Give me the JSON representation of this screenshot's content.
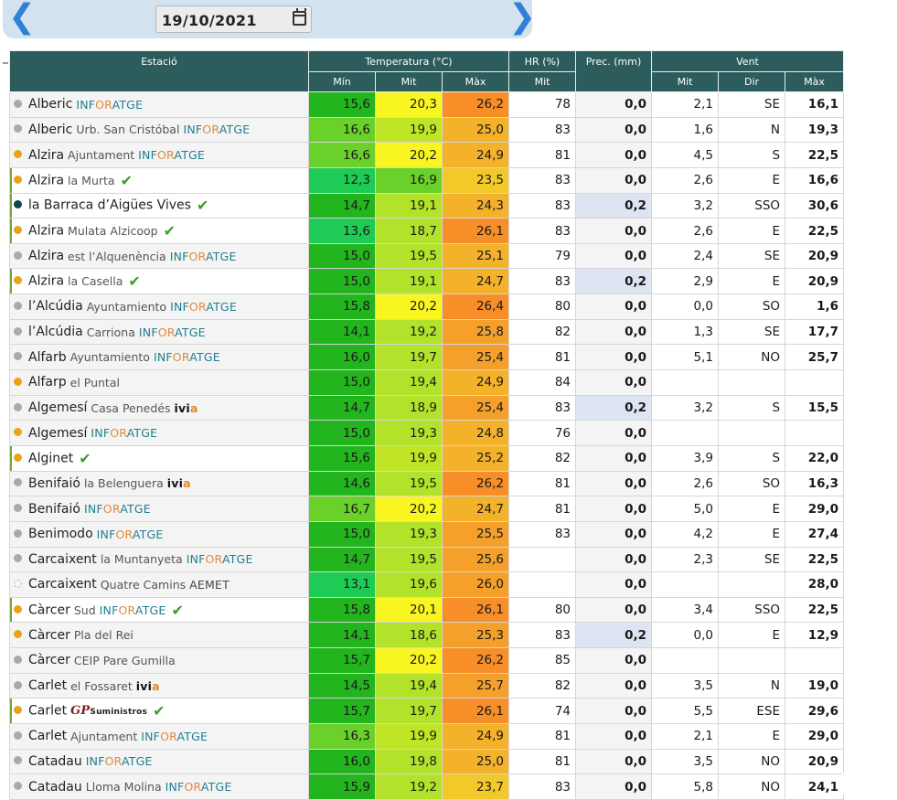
{
  "toolbar": {
    "prev_icon": "chevron-left-icon",
    "next_icon": "chevron-right-icon",
    "date_value": "19/10/2021",
    "calendar_icon": "calendar-icon",
    "prev_glyph": "❮",
    "next_glyph": "❯"
  },
  "colors": {
    "header_bg": "#2d5c5c",
    "topbar_bg": "#d2e2ef",
    "arrow": "#2f80d8",
    "dot_grey": "#a9a9a9",
    "dot_orange": "#e8a317",
    "dot_teal": "#0a4a48",
    "check": "#3f9b2a"
  },
  "table": {
    "headers_top": {
      "station": "Estació",
      "temperature": "Temperatura (°C)",
      "humidity": "HR (%)",
      "precip": "Prec. (mm)",
      "wind": "Vent"
    },
    "headers_sub": {
      "t_min": "Mín",
      "t_mit": "Mit",
      "t_max": "Màx",
      "hr_mit": "Mit",
      "v_mit": "Mit",
      "v_dir": "Dir",
      "v_max": "Màx"
    },
    "rows": [
      {
        "name": "Alberic",
        "sub": "",
        "net": "INFORATGE",
        "dot": "grey",
        "check": false,
        "owned": false,
        "tmin": "15,6",
        "tmit": "20,3",
        "tmax": "26,2",
        "hr": "78",
        "prec": "0,0",
        "prec_hi": false,
        "vmit": "2,1",
        "vdir": "SE",
        "vmax": "16,1",
        "cmin": "#22b51d",
        "cmit": "#f8f520",
        "cmax": "#f78e28"
      },
      {
        "name": "Alberic",
        "sub": "Urb. San Cristóbal",
        "net": "INFORATGE",
        "dot": "grey",
        "check": false,
        "owned": false,
        "tmin": "16,6",
        "tmit": "19,9",
        "tmax": "25,0",
        "hr": "83",
        "prec": "0,0",
        "prec_hi": false,
        "vmit": "1,6",
        "vdir": "N",
        "vmax": "19,3",
        "cmin": "#6ad12a",
        "cmit": "#c0e526",
        "cmax": "#f4b12a"
      },
      {
        "name": "Alzira",
        "sub": "Ajuntament",
        "net": "INFORATGE",
        "dot": "orange",
        "check": false,
        "owned": false,
        "tmin": "16,6",
        "tmit": "20,2",
        "tmax": "24,9",
        "hr": "81",
        "prec": "0,0",
        "prec_hi": false,
        "vmit": "4,5",
        "vdir": "S",
        "vmax": "22,5",
        "cmin": "#6ad12a",
        "cmit": "#f8f520",
        "cmax": "#f4b12a"
      },
      {
        "name": "Alzira",
        "sub": "la Murta",
        "net": "",
        "dot": "orange",
        "check": true,
        "owned": true,
        "tmin": "12,3",
        "tmit": "16,9",
        "tmax": "23,5",
        "hr": "83",
        "prec": "0,0",
        "prec_hi": false,
        "vmit": "2,6",
        "vdir": "E",
        "vmax": "16,6",
        "cmin": "#1ecb55",
        "cmit": "#6ad12a",
        "cmax": "#f3c92a"
      },
      {
        "name": "la Barraca d’Aigües Vives",
        "sub": "",
        "net": "",
        "dot": "teal",
        "check": true,
        "owned": true,
        "tmin": "14,7",
        "tmit": "19,1",
        "tmax": "24,3",
        "hr": "83",
        "prec": "0,2",
        "prec_hi": true,
        "vmit": "3,2",
        "vdir": "SSO",
        "vmax": "30,6",
        "cmin": "#22b51d",
        "cmit": "#b3e22a",
        "cmax": "#f4b12a"
      },
      {
        "name": "Alzira",
        "sub": "Mulata Alzicoop",
        "net": "",
        "dot": "orange",
        "check": true,
        "owned": true,
        "tmin": "13,6",
        "tmit": "18,7",
        "tmax": "26,1",
        "hr": "83",
        "prec": "0,0",
        "prec_hi": false,
        "vmit": "2,6",
        "vdir": "E",
        "vmax": "22,5",
        "cmin": "#1ecb55",
        "cmit": "#b3e22a",
        "cmax": "#f78e28"
      },
      {
        "name": "Alzira",
        "sub": "est l’Alquenència",
        "net": "INFORATGE",
        "dot": "grey",
        "check": false,
        "owned": false,
        "tmin": "15,0",
        "tmit": "19,5",
        "tmax": "25,1",
        "hr": "79",
        "prec": "0,0",
        "prec_hi": false,
        "vmit": "2,4",
        "vdir": "SE",
        "vmax": "20,9",
        "cmin": "#22b51d",
        "cmit": "#b3e22a",
        "cmax": "#f4b12a"
      },
      {
        "name": "Alzira",
        "sub": "la Casella",
        "net": "",
        "dot": "orange",
        "check": true,
        "owned": true,
        "tmin": "15,0",
        "tmit": "19,1",
        "tmax": "24,7",
        "hr": "83",
        "prec": "0,2",
        "prec_hi": true,
        "vmit": "2,9",
        "vdir": "E",
        "vmax": "20,9",
        "cmin": "#22b51d",
        "cmit": "#b3e22a",
        "cmax": "#f4b12a"
      },
      {
        "name": "l’Alcúdia",
        "sub": "Ayuntamiento",
        "net": "INFORATGE",
        "dot": "grey",
        "check": false,
        "owned": false,
        "tmin": "15,8",
        "tmit": "20,2",
        "tmax": "26,4",
        "hr": "80",
        "prec": "0,0",
        "prec_hi": false,
        "vmit": "0,0",
        "vdir": "SO",
        "vmax": "1,6",
        "cmin": "#22b51d",
        "cmit": "#f8f520",
        "cmax": "#f78e28"
      },
      {
        "name": "l’Alcúdia",
        "sub": "Carriona",
        "net": "INFORATGE",
        "dot": "grey",
        "check": false,
        "owned": false,
        "tmin": "14,1",
        "tmit": "19,2",
        "tmax": "25,8",
        "hr": "82",
        "prec": "0,0",
        "prec_hi": false,
        "vmit": "1,3",
        "vdir": "SE",
        "vmax": "17,7",
        "cmin": "#22b51d",
        "cmit": "#b3e22a",
        "cmax": "#f4a02a"
      },
      {
        "name": "Alfarb",
        "sub": "Ayuntamiento",
        "net": "INFORATGE",
        "dot": "grey",
        "check": false,
        "owned": false,
        "tmin": "16,0",
        "tmit": "19,7",
        "tmax": "25,4",
        "hr": "81",
        "prec": "0,0",
        "prec_hi": false,
        "vmit": "5,1",
        "vdir": "NO",
        "vmax": "25,7",
        "cmin": "#22b51d",
        "cmit": "#b3e22a",
        "cmax": "#f4a02a"
      },
      {
        "name": "Alfarp",
        "sub": "el Puntal",
        "net": "",
        "dot": "orange",
        "check": false,
        "owned": false,
        "tmin": "15,0",
        "tmit": "19,4",
        "tmax": "24,9",
        "hr": "84",
        "prec": "0,0",
        "prec_hi": false,
        "vmit": "",
        "vdir": "",
        "vmax": "",
        "cmin": "#22b51d",
        "cmit": "#b3e22a",
        "cmax": "#f4b12a"
      },
      {
        "name": "Algemesí",
        "sub": "Casa Penedés",
        "net": "ivia",
        "dot": "grey",
        "check": false,
        "owned": false,
        "tmin": "14,7",
        "tmit": "18,9",
        "tmax": "25,4",
        "hr": "83",
        "prec": "0,2",
        "prec_hi": true,
        "vmit": "3,2",
        "vdir": "S",
        "vmax": "15,5",
        "cmin": "#22b51d",
        "cmit": "#b3e22a",
        "cmax": "#f4a02a"
      },
      {
        "name": "Algemesí",
        "sub": "",
        "net": "INFORATGE",
        "dot": "orange",
        "check": false,
        "owned": false,
        "tmin": "15,0",
        "tmit": "19,3",
        "tmax": "24,8",
        "hr": "76",
        "prec": "0,0",
        "prec_hi": false,
        "vmit": "",
        "vdir": "",
        "vmax": "",
        "cmin": "#22b51d",
        "cmit": "#b3e22a",
        "cmax": "#f4b12a"
      },
      {
        "name": "Alginet",
        "sub": "",
        "net": "",
        "dot": "orange",
        "check": true,
        "owned": true,
        "tmin": "15,6",
        "tmit": "19,9",
        "tmax": "25,2",
        "hr": "82",
        "prec": "0,0",
        "prec_hi": false,
        "vmit": "3,9",
        "vdir": "S",
        "vmax": "22,0",
        "cmin": "#22b51d",
        "cmit": "#c0e526",
        "cmax": "#f4b12a"
      },
      {
        "name": "Benifaió",
        "sub": "la Belenguera",
        "net": "ivia",
        "dot": "grey",
        "check": false,
        "owned": false,
        "tmin": "14,6",
        "tmit": "19,5",
        "tmax": "26,2",
        "hr": "81",
        "prec": "0,0",
        "prec_hi": false,
        "vmit": "2,6",
        "vdir": "SO",
        "vmax": "16,3",
        "cmin": "#22b51d",
        "cmit": "#b3e22a",
        "cmax": "#f78e28"
      },
      {
        "name": "Benifaió",
        "sub": "",
        "net": "INFORATGE",
        "dot": "grey",
        "check": false,
        "owned": false,
        "tmin": "16,7",
        "tmit": "20,2",
        "tmax": "24,7",
        "hr": "81",
        "prec": "0,0",
        "prec_hi": false,
        "vmit": "5,0",
        "vdir": "E",
        "vmax": "29,0",
        "cmin": "#6ad12a",
        "cmit": "#f8f520",
        "cmax": "#f4b12a"
      },
      {
        "name": "Benimodo",
        "sub": "",
        "net": "INFORATGE",
        "dot": "grey",
        "check": false,
        "owned": false,
        "tmin": "15,0",
        "tmit": "19,3",
        "tmax": "25,5",
        "hr": "83",
        "prec": "0,0",
        "prec_hi": false,
        "vmit": "4,2",
        "vdir": "E",
        "vmax": "27,4",
        "cmin": "#22b51d",
        "cmit": "#b3e22a",
        "cmax": "#f4a02a"
      },
      {
        "name": "Carcaixent",
        "sub": "la Muntanyeta",
        "net": "INFORATGE",
        "dot": "grey",
        "check": false,
        "owned": false,
        "tmin": "14,7",
        "tmit": "19,5",
        "tmax": "25,6",
        "hr": "",
        "prec": "0,0",
        "prec_hi": false,
        "vmit": "2,3",
        "vdir": "SE",
        "vmax": "22,5",
        "cmin": "#22b51d",
        "cmit": "#b3e22a",
        "cmax": "#f4a02a"
      },
      {
        "name": "Carcaixent",
        "sub": "Quatre Camins",
        "net": "AEMET",
        "dot": "ring",
        "check": false,
        "owned": false,
        "tmin": "13,1",
        "tmit": "19,6",
        "tmax": "26,0",
        "hr": "",
        "prec": "0,0",
        "prec_hi": false,
        "vmit": "",
        "vdir": "",
        "vmax": "28,0",
        "cmin": "#1ecb55",
        "cmit": "#b3e22a",
        "cmax": "#f4a02a"
      },
      {
        "name": "Càrcer",
        "sub": "Sud",
        "net": "INFORATGE",
        "dot": "orange",
        "check": true,
        "owned": true,
        "tmin": "15,8",
        "tmit": "20,1",
        "tmax": "26,1",
        "hr": "80",
        "prec": "0,0",
        "prec_hi": false,
        "vmit": "3,4",
        "vdir": "SSO",
        "vmax": "22,5",
        "cmin": "#22b51d",
        "cmit": "#f8f520",
        "cmax": "#f78e28"
      },
      {
        "name": "Càrcer",
        "sub": "Pla del Rei",
        "net": "",
        "dot": "orange",
        "check": false,
        "owned": false,
        "tmin": "14,1",
        "tmit": "18,6",
        "tmax": "25,3",
        "hr": "83",
        "prec": "0,2",
        "prec_hi": true,
        "vmit": "0,0",
        "vdir": "E",
        "vmax": "12,9",
        "cmin": "#22b51d",
        "cmit": "#b3e22a",
        "cmax": "#f4a02a"
      },
      {
        "name": "Càrcer",
        "sub": "CEIP Pare Gumilla",
        "net": "",
        "dot": "grey",
        "check": false,
        "owned": false,
        "tmin": "15,7",
        "tmit": "20,2",
        "tmax": "26,2",
        "hr": "85",
        "prec": "0,0",
        "prec_hi": false,
        "vmit": "",
        "vdir": "",
        "vmax": "",
        "cmin": "#22b51d",
        "cmit": "#f8f520",
        "cmax": "#f78e28"
      },
      {
        "name": "Carlet",
        "sub": "el Fossaret",
        "net": "ivia",
        "dot": "grey",
        "check": false,
        "owned": false,
        "tmin": "14,5",
        "tmit": "19,4",
        "tmax": "25,7",
        "hr": "82",
        "prec": "0,0",
        "prec_hi": false,
        "vmit": "3,5",
        "vdir": "N",
        "vmax": "19,0",
        "cmin": "#22b51d",
        "cmit": "#b3e22a",
        "cmax": "#f4a02a"
      },
      {
        "name": "Carlet",
        "sub": "",
        "net": "GP",
        "dot": "orange",
        "check": true,
        "owned": true,
        "tmin": "15,7",
        "tmit": "19,7",
        "tmax": "26,1",
        "hr": "74",
        "prec": "0,0",
        "prec_hi": false,
        "vmit": "5,5",
        "vdir": "ESE",
        "vmax": "29,6",
        "cmin": "#22b51d",
        "cmit": "#b3e22a",
        "cmax": "#f78e28"
      },
      {
        "name": "Carlet",
        "sub": "Ajuntament",
        "net": "INFORATGE",
        "dot": "grey",
        "check": false,
        "owned": false,
        "tmin": "16,3",
        "tmit": "19,9",
        "tmax": "24,9",
        "hr": "81",
        "prec": "0,0",
        "prec_hi": false,
        "vmit": "2,1",
        "vdir": "E",
        "vmax": "29,0",
        "cmin": "#6ad12a",
        "cmit": "#c0e526",
        "cmax": "#f4b12a"
      },
      {
        "name": "Catadau",
        "sub": "",
        "net": "INFORATGE",
        "dot": "grey",
        "check": false,
        "owned": false,
        "tmin": "16,0",
        "tmit": "19,8",
        "tmax": "25,0",
        "hr": "81",
        "prec": "0,0",
        "prec_hi": false,
        "vmit": "3,5",
        "vdir": "NO",
        "vmax": "20,9",
        "cmin": "#22b51d",
        "cmit": "#b3e22a",
        "cmax": "#f4b12a"
      },
      {
        "name": "Catadau",
        "sub": "Lloma Molina",
        "net": "INFORATGE",
        "dot": "grey",
        "check": false,
        "owned": false,
        "tmin": "15,9",
        "tmit": "19,2",
        "tmax": "23,7",
        "hr": "83",
        "prec": "0,0",
        "prec_hi": false,
        "vmit": "5,8",
        "vdir": "NO",
        "vmax": "24,1",
        "cmin": "#22b51d",
        "cmit": "#b3e22a",
        "cmax": "#f3c92a"
      }
    ]
  }
}
